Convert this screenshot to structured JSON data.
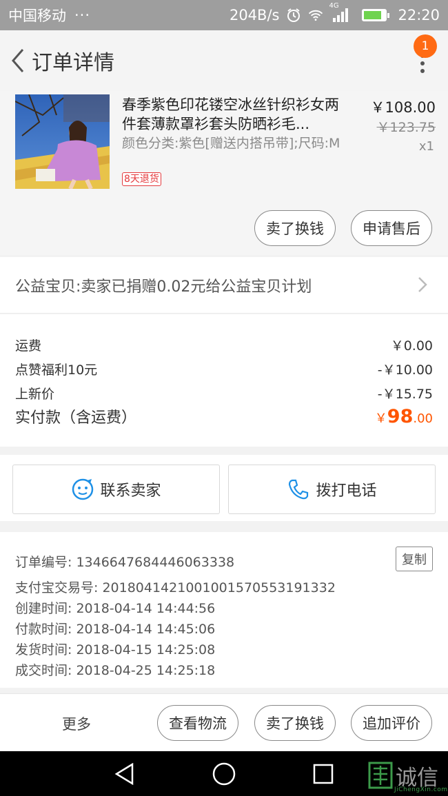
{
  "status_bar": {
    "carrier": "中国移动",
    "dots": "···",
    "net_speed": "204B/s",
    "network_type": "4G",
    "time": "22:20",
    "battery_level": 0.78
  },
  "header": {
    "title": "订单详情",
    "notification_count": "1"
  },
  "product": {
    "title": "春季紫色印花镂空冰丝针织衫女两件套薄款罩衫套头防晒衫毛...",
    "sku": "颜色分类:紫色[赠送内搭吊带];尺码:M",
    "return_tag": "8天退货",
    "price": "￥108.00",
    "original_price": "￥123.75",
    "quantity": "x1",
    "buttons": {
      "sell": "卖了换钱",
      "after_sale": "申请售后"
    }
  },
  "charity": {
    "text": "公益宝贝:卖家已捐赠0.02元给公益宝贝计划"
  },
  "fees": {
    "shipping_label": "运费",
    "shipping_value": "￥0.00",
    "like_bonus_label": "点赞福利10元",
    "like_bonus_value": "-￥10.00",
    "new_price_label": "上新价",
    "new_price_value": "-￥15.75",
    "total_label": "实付款（含运费）",
    "total_currency": "￥",
    "total_integer": "98",
    "total_decimal": ".00"
  },
  "contact": {
    "seller": "联系卖家",
    "phone": "拨打电话"
  },
  "order_info": {
    "order_no": "订单编号: 1346647684446063338",
    "alipay_no": "支付宝交易号: 2018041421001001570553191332",
    "created": "创建时间: 2018-04-14 14:44:56",
    "paid": "付款时间: 2018-04-14 14:45:06",
    "shipped": "发货时间: 2018-04-15 14:25:08",
    "completed": "成交时间: 2018-04-25 14:25:18",
    "copy": "复制"
  },
  "bottom_actions": {
    "more": "更多",
    "logistics": "查看物流",
    "sell": "卖了换钱",
    "review": "追加评价"
  },
  "watermark": {
    "text": "诚信",
    "sub": "JiChengXin.com"
  },
  "colors": {
    "accent_orange": "#ff5500",
    "badge_orange": "#ff6a13",
    "return_red": "#e4393c",
    "contact_blue": "#1e90e6"
  }
}
